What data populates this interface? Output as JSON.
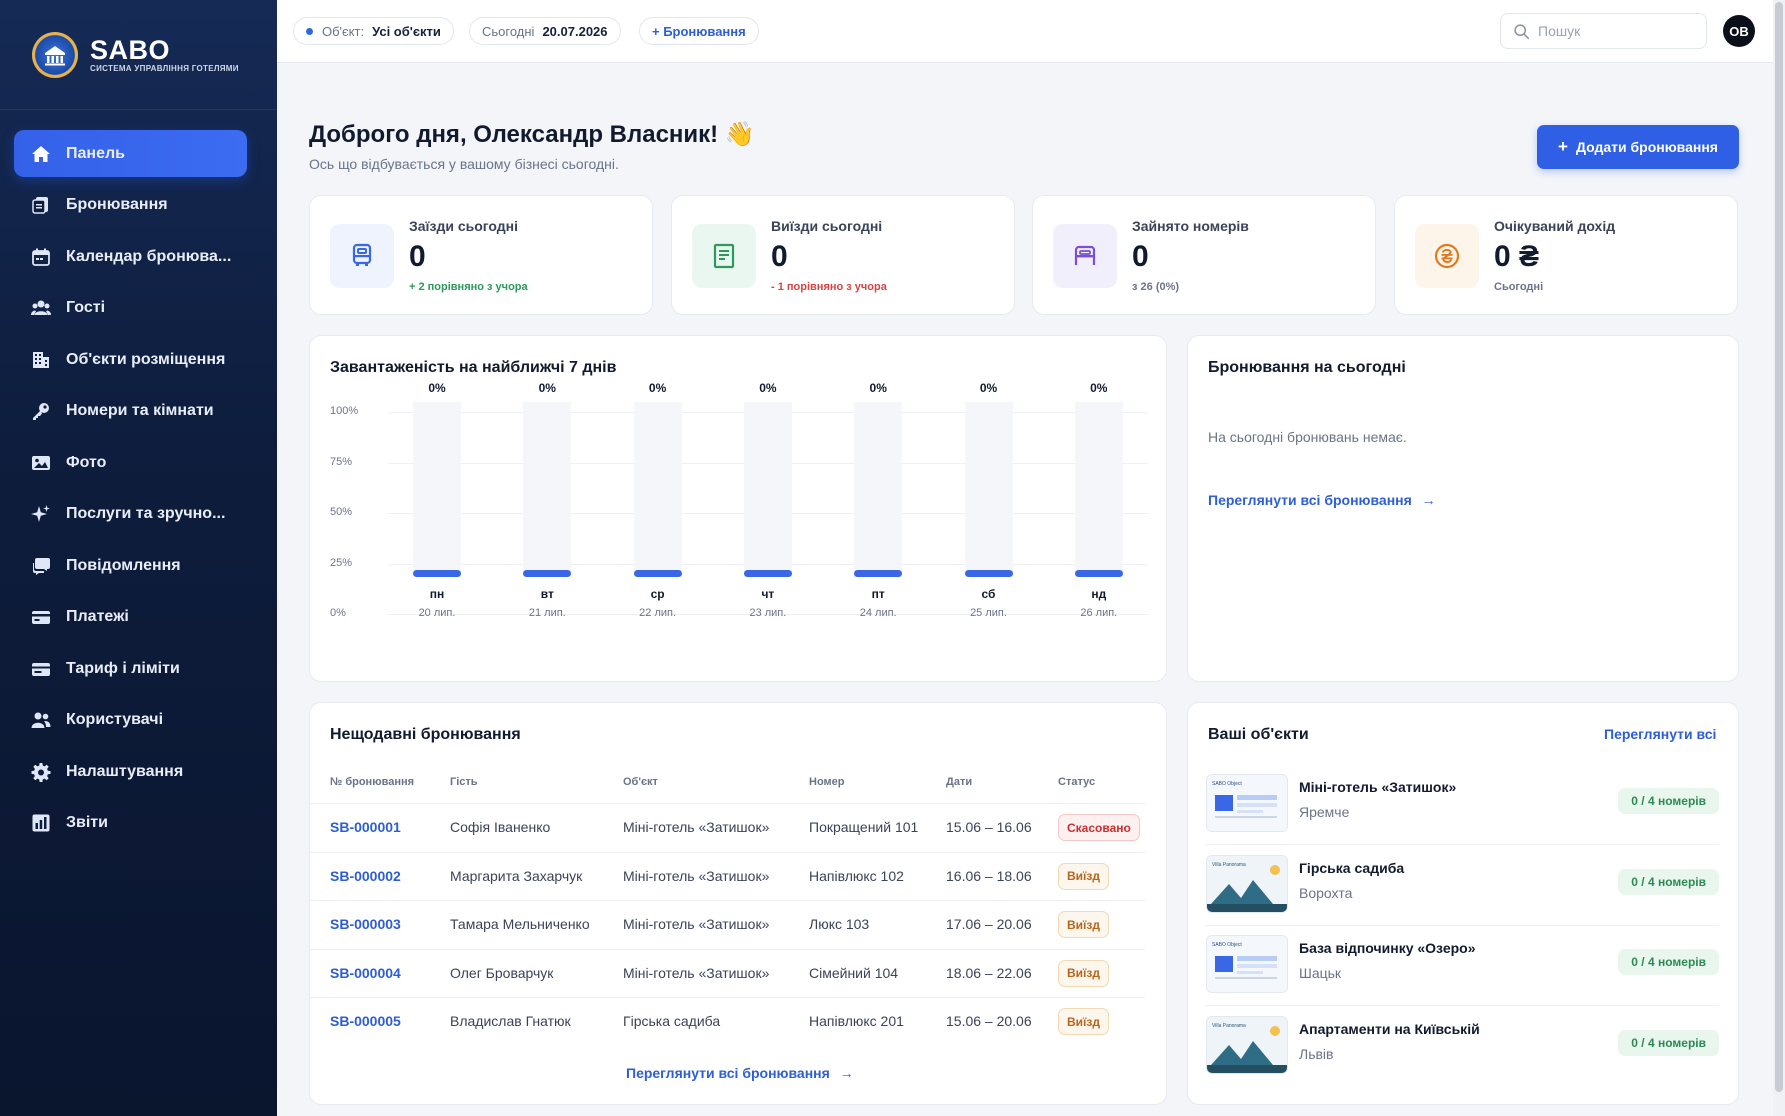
{
  "brand": {
    "name": "SABO",
    "subtitle": "СИСТЕМА УПРАВЛІННЯ ГОТЕЛЯМИ"
  },
  "sidebar": {
    "items": [
      {
        "label": "Панель",
        "icon": "home-icon",
        "active": true
      },
      {
        "label": "Бронювання",
        "icon": "bookings-icon"
      },
      {
        "label": "Календар бронюва...",
        "icon": "calendar-icon"
      },
      {
        "label": "Гості",
        "icon": "guests-icon"
      },
      {
        "label": "Об'єкти розміщення",
        "icon": "building-icon"
      },
      {
        "label": "Номери та кімнати",
        "icon": "key-icon"
      },
      {
        "label": "Фото",
        "icon": "photo-icon"
      },
      {
        "label": "Послуги та зручно...",
        "icon": "sparkle-icon"
      },
      {
        "label": "Повідомлення",
        "icon": "chat-icon"
      },
      {
        "label": "Платежі",
        "icon": "card-icon"
      },
      {
        "label": "Тариф і ліміти",
        "icon": "tariff-icon"
      },
      {
        "label": "Користувачі",
        "icon": "users-icon"
      },
      {
        "label": "Налаштування",
        "icon": "gear-icon"
      },
      {
        "label": "Звіти",
        "icon": "chart-icon"
      }
    ]
  },
  "topbar": {
    "object_label": "Об'єкт:",
    "object_value": "Усі об'єкти",
    "today_label": "Сьогодні",
    "today_value": "20.07.2026",
    "booking_link": "+ Бронювання",
    "search_placeholder": "Пошук",
    "avatar_initials": "ОВ"
  },
  "header": {
    "greeting": "Доброго дня, Олександр Власник! 👋",
    "subtitle": "Ось що відбувається у вашому бізнесі сьогодні.",
    "add_button": "Додати бронювання"
  },
  "stats": [
    {
      "label": "Заїзди сьогодні",
      "value": "0",
      "note": "+ 2 порівняно з учора",
      "note_color": "#2c9a5c",
      "icon": "checkin-icon",
      "icon_bg": "#eef3fd",
      "icon_color": "#3a67e6"
    },
    {
      "label": "Виїзди сьогодні",
      "value": "0",
      "note": "- 1 порівняно з учора",
      "note_color": "#d64545",
      "icon": "checkout-icon",
      "icon_bg": "#eaf7f0",
      "icon_color": "#2c9a5c"
    },
    {
      "label": "Зайнято номерів",
      "value": "0",
      "note": "з 26 (0%)",
      "note_color": "#6a7388",
      "icon": "bed-icon",
      "icon_bg": "#f2effc",
      "icon_color": "#7a4fd6"
    },
    {
      "label": "Очікуваний дохід",
      "value": "0 ₴",
      "note": "Сьогодні",
      "note_color": "#6a7388",
      "icon": "hryvnia-icon",
      "icon_bg": "#fdf4ea",
      "icon_color": "#e07a1f"
    }
  ],
  "occupancy": {
    "title": "Завантаженість на найближчі 7 днів"
  },
  "chart_data": {
    "type": "bar",
    "title": "Завантаженість на найближчі 7 днів",
    "categories": [
      "пн",
      "вт",
      "ср",
      "чт",
      "пт",
      "сб",
      "нд"
    ],
    "dates": [
      "20 лип.",
      "21 лип.",
      "22 лип.",
      "23 лип.",
      "24 лип.",
      "25 лип.",
      "26 лип."
    ],
    "values": [
      0,
      0,
      0,
      0,
      0,
      0,
      0
    ],
    "value_labels": [
      "0%",
      "0%",
      "0%",
      "0%",
      "0%",
      "0%",
      "0%"
    ],
    "y_ticks": [
      "100%",
      "75%",
      "50%",
      "25%",
      "0%"
    ],
    "ylim": [
      0,
      100
    ],
    "grid": true,
    "bar_color": "#3a67e6"
  },
  "today_bookings": {
    "title": "Бронювання на сьогодні",
    "empty": "На сьогодні бронювань немає.",
    "link": "Переглянути всі бронювання"
  },
  "recent": {
    "title": "Нещодавні бронювання",
    "columns": [
      "№ бронювання",
      "Гість",
      "Об'єкт",
      "Номер",
      "Дати",
      "Статус"
    ],
    "rows": [
      {
        "id": "SB-000001",
        "guest": "Софія Іваненко",
        "object": "Міні-готель «Затишок»",
        "room": "Покращений 101",
        "dates": "15.06 – 16.06",
        "status": "Скасовано",
        "kind": "cancel"
      },
      {
        "id": "SB-000002",
        "guest": "Маргарита Захарчук",
        "object": "Міні-готель «Затишок»",
        "room": "Напівлюкс 102",
        "dates": "16.06 – 18.06",
        "status": "Виїзд",
        "kind": "out"
      },
      {
        "id": "SB-000003",
        "guest": "Тамара Мельниченко",
        "object": "Міні-готель «Затишок»",
        "room": "Люкс 103",
        "dates": "17.06 – 20.06",
        "status": "Виїзд",
        "kind": "out"
      },
      {
        "id": "SB-000004",
        "guest": "Олег Броварчук",
        "object": "Міні-готель «Затишок»",
        "room": "Сімейний 104",
        "dates": "18.06 – 22.06",
        "status": "Виїзд",
        "kind": "out"
      },
      {
        "id": "SB-000005",
        "guest": "Владислав Гнатюк",
        "object": "Гірська садиба",
        "room": "Напівлюкс 201",
        "dates": "15.06 – 20.06",
        "status": "Виїзд",
        "kind": "out"
      }
    ],
    "link": "Переглянути всі бронювання"
  },
  "properties": {
    "title": "Ваші об'єкти",
    "link": "Переглянути всі",
    "items": [
      {
        "name": "Міні-готель «Затишок»",
        "city": "Яремче",
        "rooms": "0 / 4 номерів",
        "thumb": "object",
        "thumb_label": "SABO Object"
      },
      {
        "name": "Гірська садиба",
        "city": "Ворохта",
        "rooms": "0 / 4 номерів",
        "thumb": "panorama",
        "thumb_label": "Villa Panorama"
      },
      {
        "name": "База відпочинку «Озеро»",
        "city": "Шацьк",
        "rooms": "0 / 4 номерів",
        "thumb": "object",
        "thumb_label": "SABO Object"
      },
      {
        "name": "Апартаменти на Київській",
        "city": "Львів",
        "rooms": "0 / 4 номерів",
        "thumb": "panorama",
        "thumb_label": "Villa Panorama"
      }
    ]
  }
}
